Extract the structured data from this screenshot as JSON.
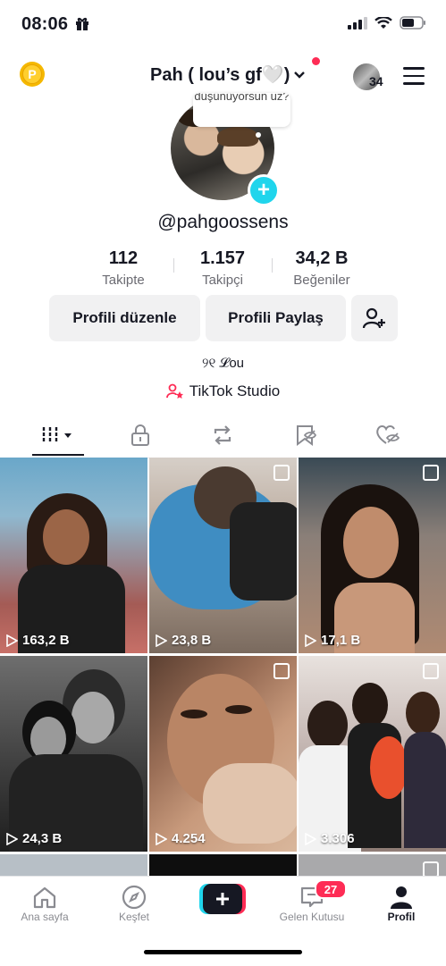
{
  "status_bar": {
    "time": "08:06"
  },
  "header": {
    "title": "Pah ( lou’s gf🤍)",
    "coin_label": "P",
    "friends_count": "34"
  },
  "profile": {
    "bubble_text": "düşünüyorsun uz?",
    "username": "@pahgoossens",
    "stats": [
      {
        "value": "112",
        "label": "Takipte"
      },
      {
        "value": "1.157",
        "label": "Takipçi"
      },
      {
        "value": "34,2 B",
        "label": "Beğeniler"
      }
    ],
    "edit_label": "Profili düzenle",
    "share_label": "Profili Paylaş",
    "bio": "୨୧ 𝓛ou",
    "studio_label": "TikTok Studio"
  },
  "videos": [
    {
      "views": "163,2 B"
    },
    {
      "views": "23,8 B"
    },
    {
      "views": "17,1 B"
    },
    {
      "views": "24,3 B"
    },
    {
      "views": "4.254"
    },
    {
      "views": "3.306"
    }
  ],
  "nav": {
    "home": "Ana sayfa",
    "discover": "Keşfet",
    "inbox": "Gelen Kutusu",
    "inbox_badge": "27",
    "profile": "Profil"
  },
  "colors": {
    "accent": "#fe2c55",
    "cyan": "#20d5ec",
    "text": "#161823"
  }
}
